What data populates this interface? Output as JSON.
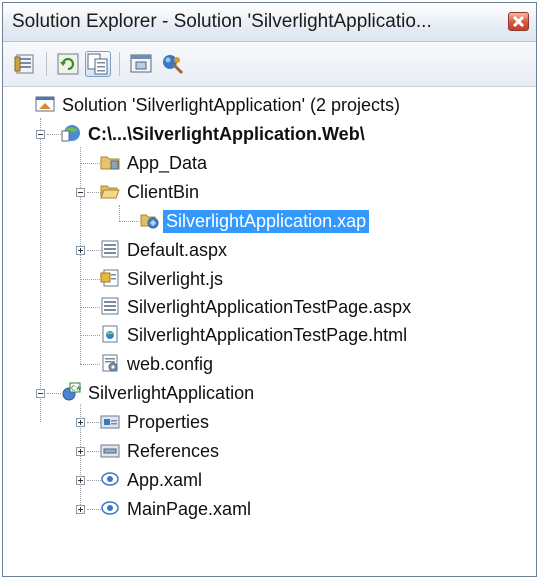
{
  "window": {
    "title": "Solution Explorer - Solution 'SilverlightApplicatio..."
  },
  "toolbar": {
    "buttons": [
      {
        "icon": "properties-icon"
      },
      {
        "icon": "refresh-icon"
      },
      {
        "icon": "show-all-files-icon",
        "pressed": true
      },
      {
        "icon": "view-designer-icon"
      },
      {
        "icon": "wcf-config-icon"
      }
    ]
  },
  "tree": {
    "solution": "Solution 'SilverlightApplication' (2 projects)",
    "web_project": "C:\\...\\SilverlightApplication.Web\\",
    "app_data": "App_Data",
    "client_bin": "ClientBin",
    "xap_file": "SilverlightApplication.xap",
    "default_aspx": "Default.aspx",
    "silverlight_js": "Silverlight.js",
    "test_page_aspx": "SilverlightApplicationTestPage.aspx",
    "test_page_html": "SilverlightApplicationTestPage.html",
    "web_config": "web.config",
    "sl_project": "SilverlightApplication",
    "properties": "Properties",
    "references": "References",
    "app_xaml": "App.xaml",
    "main_page_xaml": "MainPage.xaml"
  },
  "colors": {
    "selection": "#3399ff",
    "close_button": "#d7573a"
  }
}
